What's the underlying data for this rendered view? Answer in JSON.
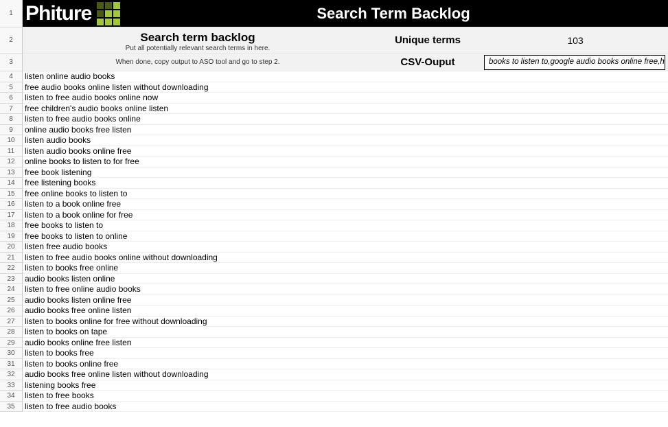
{
  "brand": {
    "name": "Phiture"
  },
  "header": {
    "title": "Search Term Backlog"
  },
  "backlog_panel": {
    "title": "Search term backlog",
    "subtitle1": "Put all potentially relevant search terms in here.",
    "subtitle2": "When done, copy output to ASO tool and go to step 2."
  },
  "stats": {
    "unique_terms_label": "Unique terms",
    "unique_terms_value": "103",
    "csv_label": "CSV-Ouput",
    "csv_value": "books to listen to,google audio books online free,how to"
  },
  "row_numbers": [
    "1",
    "2",
    "3",
    "4",
    "5",
    "6",
    "7",
    "8",
    "9",
    "10",
    "11",
    "12",
    "13",
    "14",
    "15",
    "16",
    "17",
    "18",
    "19",
    "20",
    "21",
    "22",
    "23",
    "24",
    "25",
    "26",
    "27",
    "28",
    "29",
    "30",
    "31",
    "32",
    "33",
    "34",
    "35"
  ],
  "terms": [
    "listen online audio books",
    "free audio books online listen without downloading",
    "listen to free audio books online now",
    "free children's audio books online listen",
    "listen to free audio books online",
    "online audio books free listen",
    "listen audio books",
    "listen audio books online free",
    "online books to listen to for free",
    "free book listening",
    "free listening books",
    "free online books to listen to",
    "listen to a book online free",
    "listen to a book online for free",
    "free books to listen to",
    "free books to listen to online",
    "listen free audio books",
    "listen to free audio books online without downloading",
    "listen to books free online",
    "audio books listen online",
    "listen to free online audio books",
    "audio books listen online free",
    "audio books free online listen",
    "listen to books online for free without downloading",
    "listen to books on tape",
    "audio books online free listen",
    "listen to books free",
    "listen to books online free",
    "audio books free online listen without downloading",
    "listening books free",
    "listen to free books",
    "listen to free audio books"
  ]
}
